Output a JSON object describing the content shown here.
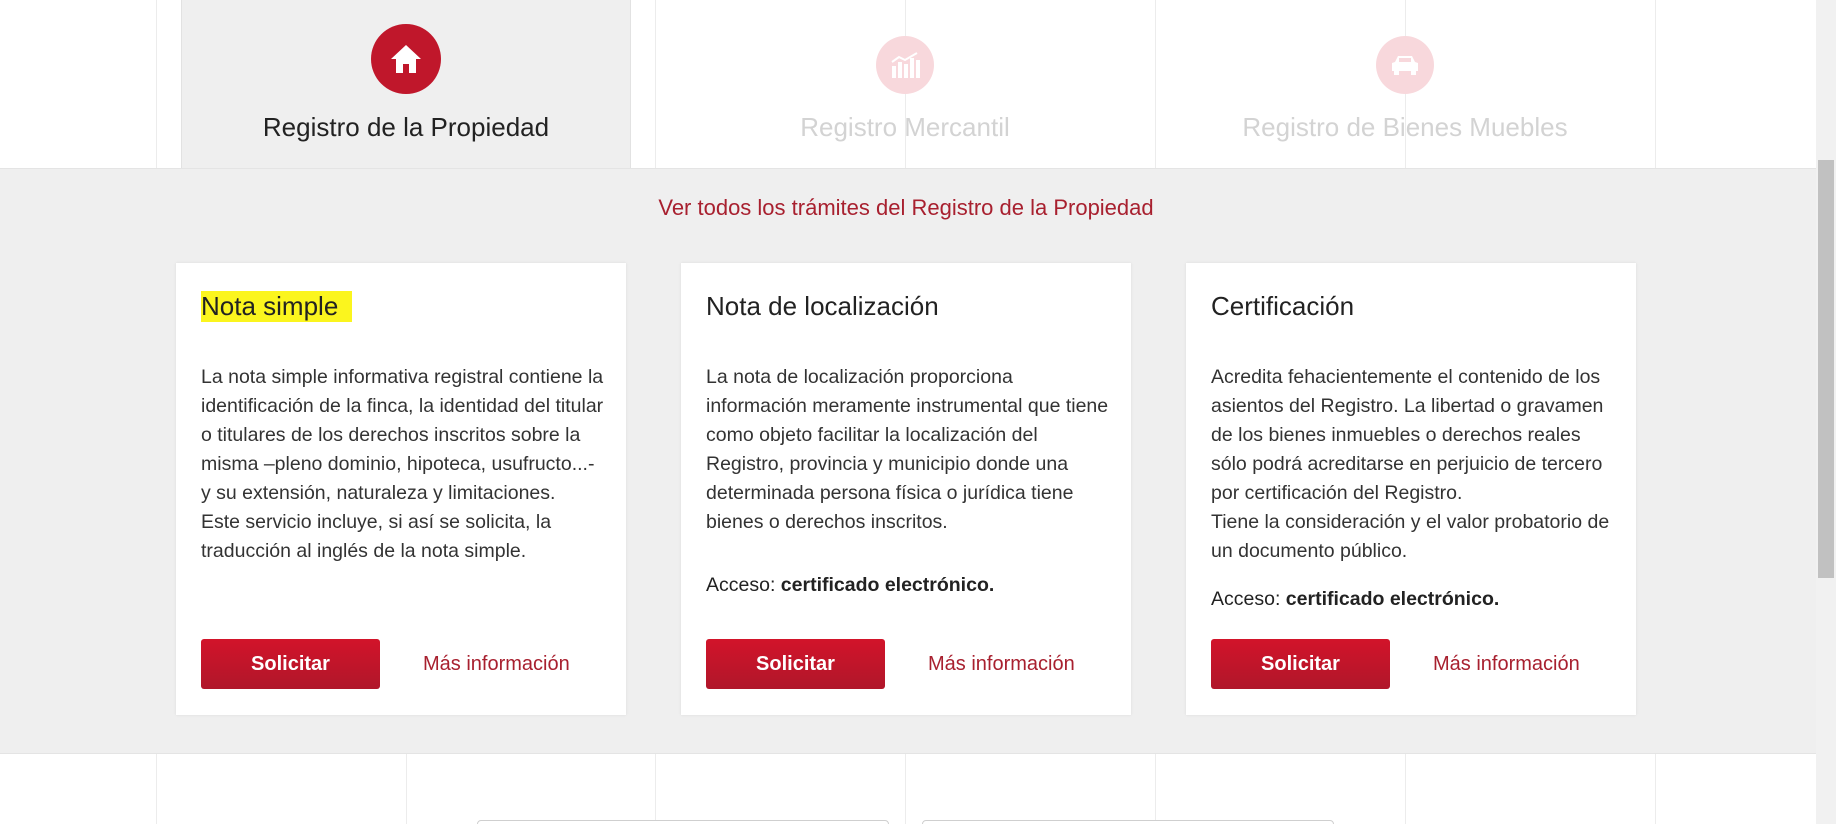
{
  "tabs": [
    {
      "label": "Registro de la Propiedad",
      "icon": "house-icon",
      "active": true
    },
    {
      "label": "Registro Mercantil",
      "icon": "bar-chart-icon",
      "active": false
    },
    {
      "label": "Registro de Bienes Muebles",
      "icon": "car-icon",
      "active": false
    }
  ],
  "section": {
    "all_link": "Ver todos los trámites del Registro de la Propiedad"
  },
  "cards": [
    {
      "title": "Nota simple",
      "body": [
        "La nota simple informativa registral contiene la identificación de la finca, la identidad del titular o titulares de los derechos inscritos sobre la misma –pleno dominio, hipoteca, usufructo...- y su extensión, naturaleza y limitaciones.",
        "Este servicio incluye, si así se solicita, la traducción al inglés de la nota simple."
      ],
      "access_label": "",
      "access_value": "",
      "button": "Solicitar",
      "more": "Más información"
    },
    {
      "title": "Nota de localización",
      "body": [
        "La nota de localización proporciona información meramente instrumental que tiene como objeto facilitar la localización del Registro, provincia y municipio donde una determinada persona física o jurídica tiene bienes o derechos inscritos."
      ],
      "access_label": "Acceso: ",
      "access_value": "certificado electrónico.",
      "button": "Solicitar",
      "more": "Más información"
    },
    {
      "title": "Certificación",
      "body": [
        "Acredita fehacientemente el contenido de los asientos del Registro. La libertad o gravamen de los bienes inmuebles o derechos reales sólo podrá acreditarse en perjuicio de tercero por certificación del Registro.",
        "Tiene la consideración y el valor probatorio de un documento público."
      ],
      "access_label": "Acceso: ",
      "access_value": "certificado electrónico.",
      "button": "Solicitar",
      "more": "Más información"
    }
  ],
  "colors": {
    "brand_red": "#c0172b",
    "link_red": "#a8202f",
    "highlight": "#fbf51e",
    "section_bg": "#efefef"
  }
}
